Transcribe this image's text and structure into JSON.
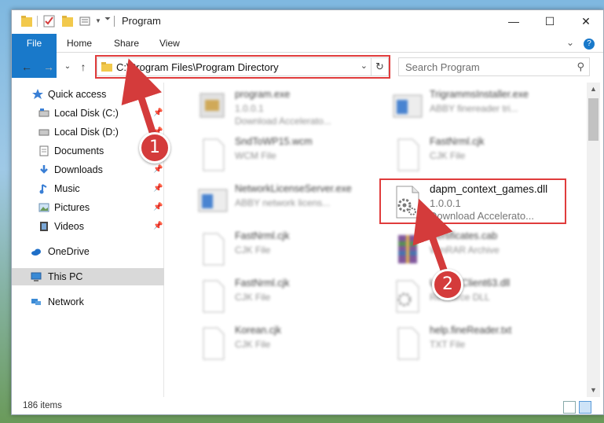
{
  "window": {
    "title": "Program",
    "controls": {
      "minimize": "—",
      "maximize": "☐",
      "close": "✕"
    }
  },
  "ribbon": {
    "tabs": [
      "File",
      "Home",
      "Share",
      "View"
    ],
    "expand_icon": "⌄",
    "help_icon": "?"
  },
  "navbar": {
    "back": "←",
    "forward": "→",
    "recent": "⌄",
    "up": "↑",
    "address": "C:\\Program Files\\Program Directory",
    "search_placeholder": "Search Program"
  },
  "sidebar": {
    "items": [
      {
        "label": "Quick access",
        "icon": "star-icon",
        "pinned": false
      },
      {
        "label": "Local Disk (C:)",
        "icon": "drive-icon",
        "pinned": true
      },
      {
        "label": "Local Disk (D:)",
        "icon": "drive-icon",
        "pinned": true
      },
      {
        "label": "Documents",
        "icon": "documents-icon",
        "pinned": true
      },
      {
        "label": "Downloads",
        "icon": "downloads-icon",
        "pinned": true
      },
      {
        "label": "Music",
        "icon": "music-icon",
        "pinned": true
      },
      {
        "label": "Pictures",
        "icon": "pictures-icon",
        "pinned": true
      },
      {
        "label": "Videos",
        "icon": "videos-icon",
        "pinned": true
      },
      {
        "label": "OneDrive",
        "icon": "onedrive-icon",
        "pinned": false
      },
      {
        "label": "This PC",
        "icon": "pc-icon",
        "pinned": false
      },
      {
        "label": "Network",
        "icon": "network-icon",
        "pinned": false
      }
    ]
  },
  "files": [
    {
      "name": "program.exe",
      "sub1": "1.0.0.1",
      "sub2": "Download Accelerato...",
      "icon": "exe-icon"
    },
    {
      "name": "TrigrammsInstaller.exe",
      "sub1": "ABBY finereader tri...",
      "sub2": "",
      "icon": "window-icon"
    },
    {
      "name": "SndToWP15.wcm",
      "sub1": "WCM File",
      "sub2": "",
      "icon": "blank-file-icon"
    },
    {
      "name": "FastNrml.cjk",
      "sub1": "CJK File",
      "sub2": "",
      "icon": "blank-file-icon"
    },
    {
      "name": "NetworkLicenseServer.exe",
      "sub1": "ABBY network licens...",
      "sub2": "",
      "icon": "window-icon"
    },
    {
      "name": "dapm_context_games.dll",
      "sub1": "1.0.0.1",
      "sub2": "Download Accelerato...",
      "icon": "dll-icon"
    },
    {
      "name": "FastNrml.cjk",
      "sub1": "CJK File",
      "sub2": "",
      "icon": "blank-file-icon"
    },
    {
      "name": "Certificates.cab",
      "sub1": "WinRAR Archive",
      "sub2": "",
      "icon": "archive-icon"
    },
    {
      "name": "FastNrml.cjk",
      "sub1": "CJK File",
      "sub2": "",
      "icon": "blank-file-icon"
    },
    {
      "name": "UpdateClient63.dll",
      "sub1": "Resource DLL",
      "sub2": "",
      "icon": "dll-icon"
    },
    {
      "name": "Korean.cjk",
      "sub1": "CJK File",
      "sub2": "",
      "icon": "blank-file-icon"
    },
    {
      "name": "help.fineReader.txt",
      "sub1": "TXT File",
      "sub2": "",
      "icon": "blank-file-icon"
    }
  ],
  "status": {
    "item_count": "186 items"
  },
  "annotations": {
    "step1": "1",
    "step2": "2",
    "color": "#d43b3b"
  }
}
